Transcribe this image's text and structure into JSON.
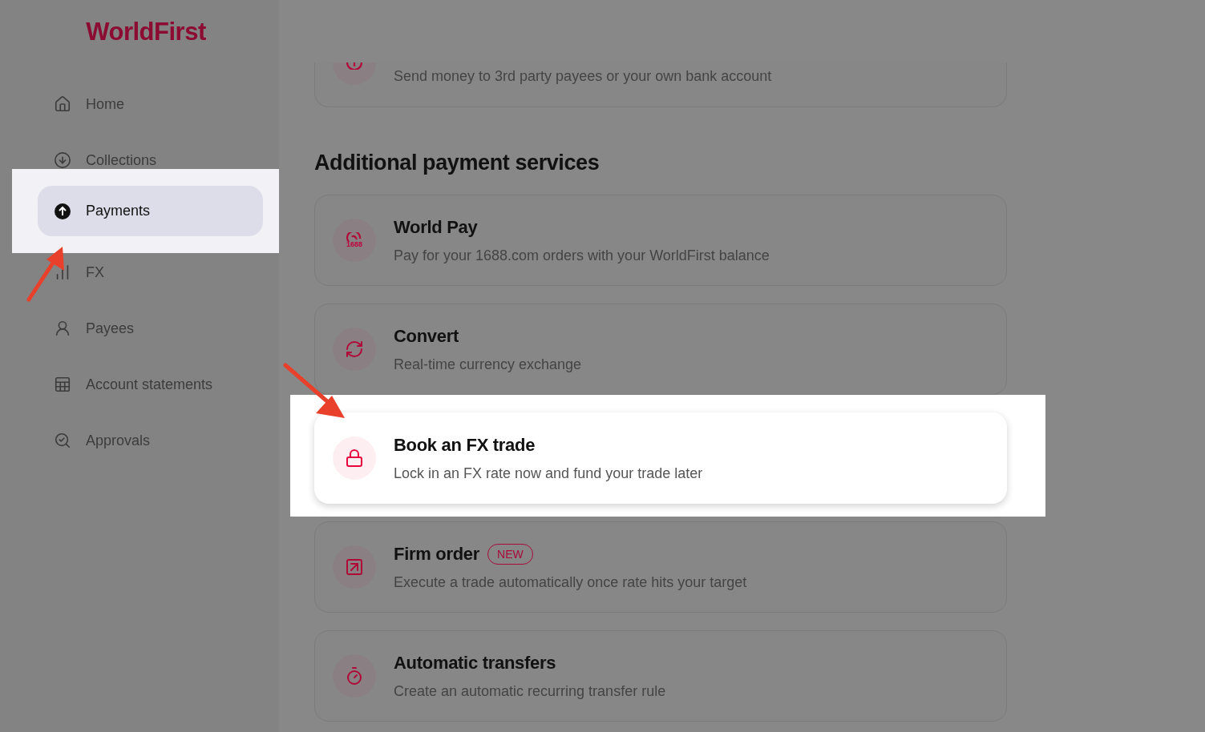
{
  "sidebar": {
    "logo": "WorldFirst",
    "nav": [
      {
        "label": "Home",
        "selected": false,
        "highlighted": false
      },
      {
        "label": "Collections",
        "selected": false,
        "highlighted": false
      },
      {
        "label": "Payments",
        "selected": true,
        "highlighted": true
      },
      {
        "label": "FX",
        "selected": false,
        "highlighted": false
      },
      {
        "label": "Payees",
        "selected": false,
        "highlighted": false
      },
      {
        "label": "Account statements",
        "selected": false,
        "highlighted": false
      },
      {
        "label": "Approvals",
        "selected": false,
        "highlighted": false
      }
    ]
  },
  "top_card": {
    "description": "Send money to 3rd party payees or your own bank account"
  },
  "section_title": "Additional payment services",
  "services": [
    {
      "title": "World Pay",
      "description": "Pay for your 1688.com orders with your WorldFirst balance",
      "icon_text": "1688",
      "highlighted": false
    },
    {
      "title": "Convert",
      "description": "Real-time currency exchange",
      "highlighted": false
    },
    {
      "title": "Book an FX trade",
      "description": "Lock in an FX rate now and fund your trade later",
      "highlighted": true
    },
    {
      "title": "Firm order",
      "badge": "NEW",
      "description": "Execute a trade automatically once rate hits your target",
      "highlighted": false
    },
    {
      "title": "Automatic transfers",
      "description": "Create an automatic recurring transfer rule",
      "highlighted": false
    }
  ]
}
